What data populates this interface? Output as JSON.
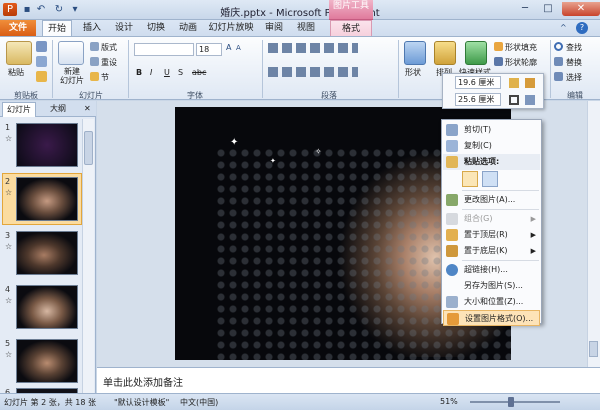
{
  "window": {
    "title": "婚庆.pptx - Microsoft PowerPoint",
    "picture_tools": "图片工具",
    "min": "─",
    "max": "□",
    "close": "✕"
  },
  "tabs": [
    "文件",
    "开始",
    "插入",
    "设计",
    "切换",
    "动画",
    "幻灯片放映",
    "审阅",
    "视图",
    "格式"
  ],
  "ribbon": {
    "clipboard": {
      "label": "剪贴板",
      "paste": "粘贴"
    },
    "slides": {
      "label": "幻灯片",
      "new_slide": "新建\n幻灯片",
      "layout": "版式",
      "reset": "重设",
      "section": "节"
    },
    "font": {
      "label": "字体",
      "size": "18",
      "bold": "B",
      "italic": "I",
      "underline": "U",
      "shadow": "S",
      "strike": "abc"
    },
    "paragraph": {
      "label": "段落"
    },
    "drawing": {
      "shape": "形状",
      "arrange": "排列",
      "quick_styles": "快速样式",
      "shape_fill": "形状填充",
      "shape_outline": "形状轮廓"
    },
    "editing": {
      "label": "编辑",
      "find": "查找",
      "replace": "替换",
      "select": "选择"
    }
  },
  "mini_toolbar": {
    "height": "19.6 厘米",
    "width": "25.6 厘米"
  },
  "left_pane": {
    "tab_slides": "幻灯片",
    "tab_outline": "大纲",
    "close": "✕",
    "thumbs": [
      {
        "num": "1",
        "star": "☆"
      },
      {
        "num": "2",
        "star": "☆"
      },
      {
        "num": "3",
        "star": "☆"
      },
      {
        "num": "4",
        "star": "☆"
      },
      {
        "num": "5",
        "star": "☆"
      },
      {
        "num": "6",
        "star": ""
      }
    ]
  },
  "notes": {
    "placeholder": "单击此处添加备注"
  },
  "status": {
    "slide": "幻灯片 第 2 张，共 18 张",
    "theme": "\"默认设计模板\"",
    "lang": "中文(中国)",
    "zoom": "51%"
  },
  "context_menu": {
    "items": [
      {
        "label": "剪切(T)",
        "disabled": false
      },
      {
        "label": "复制(C)",
        "disabled": false
      },
      {
        "label": "粘贴选项:",
        "disabled": false
      },
      {
        "label": "更改图片(A)...",
        "disabled": false
      },
      {
        "label": "组合(G)",
        "disabled": true
      },
      {
        "label": "置于顶层(R)",
        "disabled": false
      },
      {
        "label": "置于底层(K)",
        "disabled": false
      },
      {
        "label": "超链接(H)...",
        "disabled": false
      },
      {
        "label": "另存为图片(S)...",
        "disabled": false
      },
      {
        "label": "大小和位置(Z)...",
        "disabled": false
      },
      {
        "label": "设置图片格式(O)...",
        "disabled": false
      }
    ]
  },
  "colors": {
    "accent": "#f08e3a",
    "picture_tools": "#e07a9c",
    "hover": "#fde3b8"
  }
}
